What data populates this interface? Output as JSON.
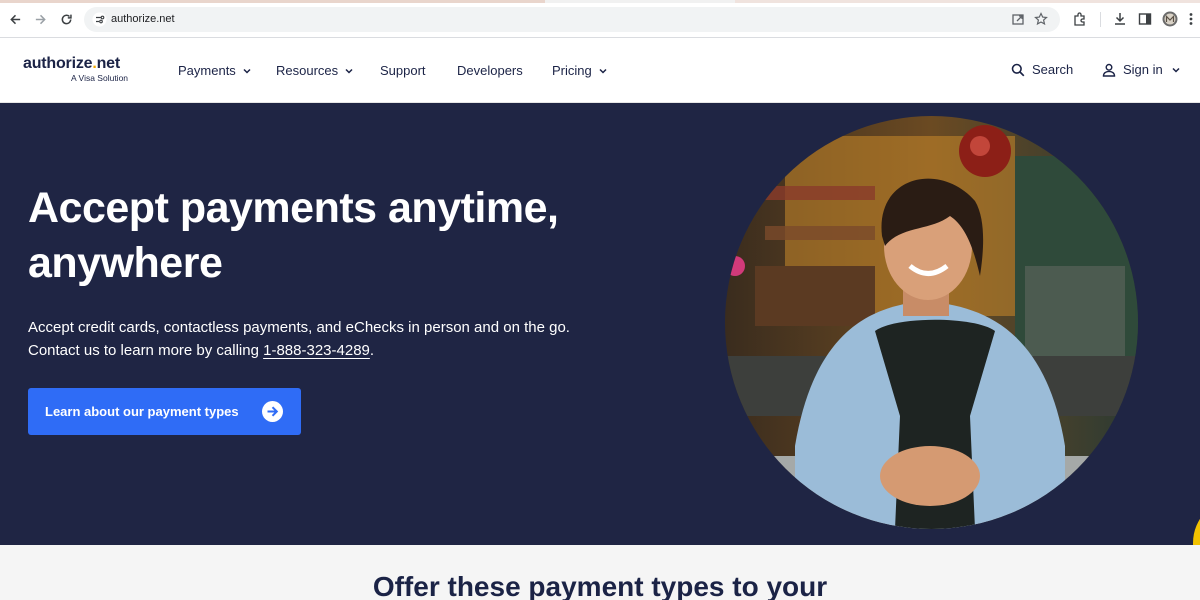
{
  "browser": {
    "url": "authorize.net",
    "icons": [
      "back-icon",
      "forward-icon",
      "reload-icon",
      "site-info-icon",
      "share-icon",
      "bookmark-star-icon",
      "extensions-icon",
      "download-icon",
      "sidepanel-icon",
      "profile-avatar",
      "more-menu-icon"
    ]
  },
  "header": {
    "logo_text": "authorize",
    "logo_dot": ".",
    "logo_tld": "net",
    "logo_sub": "A Visa Solution",
    "nav": [
      {
        "label": "Payments",
        "dropdown": true
      },
      {
        "label": "Resources",
        "dropdown": true
      },
      {
        "label": "Support",
        "dropdown": false
      },
      {
        "label": "Developers",
        "dropdown": false
      },
      {
        "label": "Pricing",
        "dropdown": true
      }
    ],
    "search_label": "Search",
    "signin_label": "Sign in"
  },
  "hero": {
    "title": "Accept payments anytime, anywhere",
    "desc_line1": "Accept credit cards, contactless payments, and eChecks in person and on the go.",
    "desc_line2_prefix": "Contact us to learn more by calling ",
    "phone": "1-888-323-4289",
    "desc_line2_suffix": ".",
    "cta_label": "Learn about our payment types"
  },
  "section": {
    "heading": "Offer these payment types to your"
  },
  "colors": {
    "navy": "#1f2544",
    "brand_text": "#1b2346",
    "cta_blue": "#2f6cf6",
    "accent_yellow": "#f2a900"
  }
}
